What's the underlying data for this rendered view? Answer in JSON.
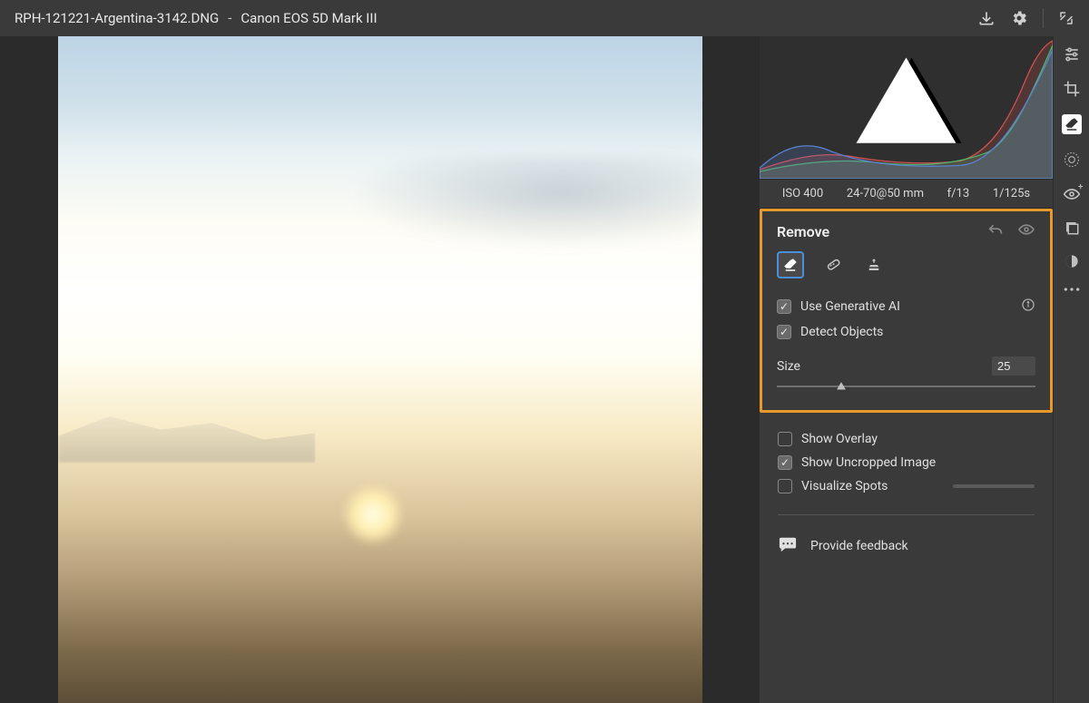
{
  "header": {
    "filename": "RPH-121221-Argentina-3142.DNG",
    "separator": "-",
    "camera": "Canon EOS 5D Mark III"
  },
  "exif": {
    "iso": "ISO 400",
    "lens": "24-70@50 mm",
    "aperture": "f/13",
    "shutter": "1/125s"
  },
  "remove": {
    "title": "Remove",
    "use_gen_ai_label": "Use Generative AI",
    "detect_objects_label": "Detect Objects",
    "size_label": "Size",
    "size_value": "25",
    "size_percent": 25
  },
  "options": {
    "show_overlay_label": "Show Overlay",
    "show_uncropped_label": "Show Uncropped Image",
    "visualize_spots_label": "Visualize Spots"
  },
  "feedback": {
    "label": "Provide feedback"
  }
}
